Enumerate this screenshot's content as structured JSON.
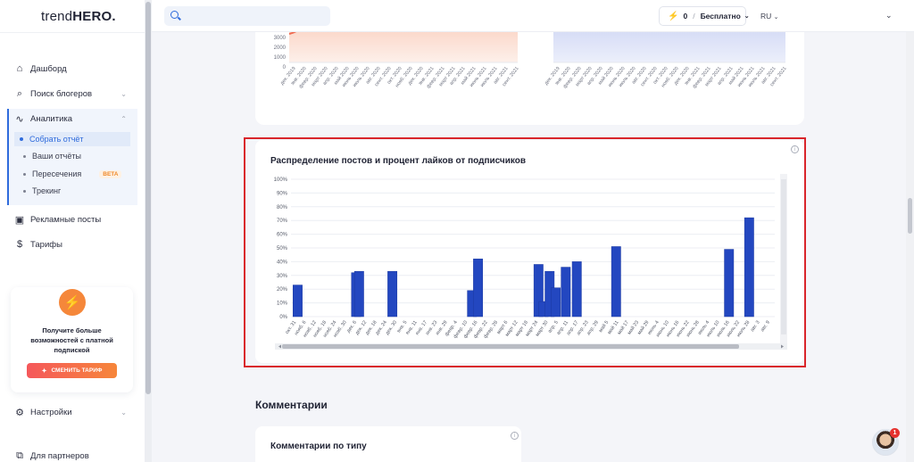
{
  "app": {
    "logo_text": "trend",
    "logo_bold": "HERO."
  },
  "sidebar": {
    "items": [
      {
        "label": "Дашборд",
        "icon": "home-icon"
      },
      {
        "label": "Поиск блогеров",
        "icon": "search-icon"
      },
      {
        "label": "Аналитика",
        "icon": "pulse-icon"
      },
      {
        "label": "Рекламные посты",
        "icon": "ad-post-icon"
      },
      {
        "label": "Тарифы",
        "icon": "dollar-icon"
      },
      {
        "label": "Настройки",
        "icon": "gear-icon"
      },
      {
        "label": "Для партнеров",
        "icon": "handshake-icon"
      }
    ],
    "analytics_sub": [
      {
        "label": "Собрать отчёт"
      },
      {
        "label": "Ваши отчёты"
      },
      {
        "label": "Пересечения",
        "badge": "BETA"
      },
      {
        "label": "Трекинг"
      }
    ],
    "promo": {
      "text": "Получите больше возможностей с платной подпиской",
      "button": "СМЕНИТЬ ТАРИФ"
    }
  },
  "topbar": {
    "search_placeholder": "",
    "plan_count": "0",
    "plan_name": "Бесплатно",
    "language": "RU"
  },
  "prev_charts": {
    "left_ticks": [
      "3000",
      "2000",
      "1000",
      "0"
    ],
    "left_labels": [
      "дек. 2019",
      "янв. 2020",
      "февр. 2020",
      "март 2020",
      "апр. 2020",
      "май 2020",
      "июнь 2020",
      "июль 2020",
      "авг. 2020",
      "сент. 2020",
      "окт. 2020",
      "нояб. 2020",
      "дек. 2020",
      "янв. 2021",
      "февр. 2021",
      "март 2021",
      "апр. 2021",
      "май 2021",
      "июнь 2021",
      "июль 2021",
      "авг. 2021",
      "сент. 2021"
    ],
    "right_labels": [
      "дек. 2019",
      "янв. 2020",
      "февр. 2020",
      "март 2020",
      "апр. 2020",
      "май 2020",
      "июнь 2020",
      "июль 2020",
      "авг. 2020",
      "сент. 2020",
      "окт. 2020",
      "нояб. 2020",
      "дек. 2020",
      "янв. 2021",
      "февр. 2021",
      "март 2021",
      "апр. 2021",
      "май 2021",
      "июнь 2021",
      "июль 2021",
      "авг. 2021",
      "сент. 2021"
    ]
  },
  "chart_card": {
    "title": "Распределение постов и процент лайков от подписчиков"
  },
  "chart_data": {
    "type": "bar",
    "title": "Распределение постов и процент лайков от подписчиков",
    "ylim": [
      0,
      100
    ],
    "yticks": [
      "0%",
      "10%",
      "20%",
      "30%",
      "40%",
      "50%",
      "60%",
      "70%",
      "80%",
      "90%",
      "100%"
    ],
    "categories": [
      "окт. 31",
      "нояб. 6",
      "нояб. 12",
      "нояб. 18",
      "нояб. 24",
      "нояб. 30",
      "дек. 6",
      "дек. 12",
      "дек. 18",
      "дек. 24",
      "дек. 30",
      "янв. 5",
      "янв. 11",
      "янв. 17",
      "янв. 23",
      "янв. 29",
      "февр. 4",
      "февр. 10",
      "февр. 16",
      "февр. 22",
      "февр. 28",
      "март 6",
      "март 12",
      "март 18",
      "март 24",
      "март 30",
      "апр. 5",
      "апр. 11",
      "апр. 17",
      "апр. 23",
      "апр. 29",
      "май 5",
      "май 11",
      "май 17",
      "май 23",
      "май 29",
      "июнь 4",
      "июнь 10",
      "июнь 16",
      "июнь 22",
      "июнь 28",
      "июль 4",
      "июль 10",
      "июль 16",
      "июль 22",
      "июль 28",
      "авг. 3",
      "авг. 9"
    ],
    "bars": [
      {
        "x": 0.2,
        "value": 23
      },
      {
        "x": 6.0,
        "value": 32
      },
      {
        "x": 6.3,
        "value": 33
      },
      {
        "x": 9.6,
        "value": 33
      },
      {
        "x": 17.5,
        "value": 19
      },
      {
        "x": 18.1,
        "value": 42
      },
      {
        "x": 24.1,
        "value": 38
      },
      {
        "x": 24.6,
        "value": 11
      },
      {
        "x": 25.2,
        "value": 33
      },
      {
        "x": 25.8,
        "value": 21
      },
      {
        "x": 26.8,
        "value": 36
      },
      {
        "x": 27.9,
        "value": 40
      },
      {
        "x": 31.8,
        "value": 51
      },
      {
        "x": 43.0,
        "value": 49
      },
      {
        "x": 45.0,
        "value": 72
      }
    ],
    "grid": true,
    "legend": "none"
  },
  "comments": {
    "section_title": "Комментарии",
    "card_title": "Комментарии по типу"
  },
  "chat": {
    "badge": "1"
  }
}
